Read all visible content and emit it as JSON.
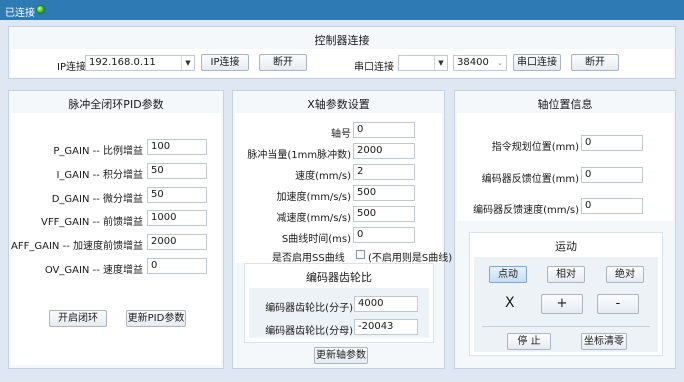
{
  "status": {
    "connected_label": "已连接"
  },
  "controller": {
    "title": "控制器连接",
    "ip_label": "IP连接",
    "ip_value": "192.168.0.11",
    "ip_connect": "IP连接",
    "ip_disconnect": "断开",
    "serial_label": "串口连接",
    "serial_port": "",
    "baud": "38400",
    "serial_connect": "串口连接",
    "serial_disconnect": "断开"
  },
  "pid": {
    "title": "脉冲全闭环PID参数",
    "rows": [
      {
        "label": "P_GAIN -- 比例增益",
        "value": "100"
      },
      {
        "label": "I_GAIN -- 积分增益",
        "value": "50"
      },
      {
        "label": "D_GAIN -- 微分增益",
        "value": "50"
      },
      {
        "label": "VFF_GAIN -- 前馈增益",
        "value": "1000"
      },
      {
        "label": "AFF_GAIN -- 加速度前馈增益",
        "value": "2000"
      },
      {
        "label": "OV_GAIN -- 速度增益",
        "value": "0"
      }
    ],
    "open_loop": "开启闭环",
    "update": "更新PID参数"
  },
  "axis": {
    "title": "X轴参数设置",
    "rows": [
      {
        "label": "轴号",
        "value": "0"
      },
      {
        "label": "脉冲当量(1mm脉冲数)",
        "value": "2000"
      },
      {
        "label": "速度(mm/s)",
        "value": "2"
      },
      {
        "label": "加速度(mm/s/s)",
        "value": "500"
      },
      {
        "label": "减速度(mm/s/s)",
        "value": "500"
      },
      {
        "label": "S曲线时间(ms)",
        "value": "0"
      }
    ],
    "ss_label": "是否启用SS曲线",
    "ss_hint": "(不启用则是S曲线)",
    "gear_title": "编码器齿轮比",
    "gear_num_label": "编码器齿轮比(分子)",
    "gear_num": "4000",
    "gear_den_label": "编码器齿轮比(分母)",
    "gear_den": "-20043",
    "update": "更新轴参数"
  },
  "position": {
    "title": "轴位置信息",
    "rows": [
      {
        "label": "指令规划位置(mm)",
        "value": "0"
      },
      {
        "label": "编码器反馈位置(mm)",
        "value": "0"
      },
      {
        "label": "编码器反馈速度(mm/s)",
        "value": "0"
      }
    ]
  },
  "motion": {
    "title": "运动",
    "modes": [
      "点动",
      "相对",
      "绝对"
    ],
    "axis_label": "X",
    "plus": "+",
    "minus": "-",
    "stop": "停 止",
    "clear": "坐标清零"
  }
}
